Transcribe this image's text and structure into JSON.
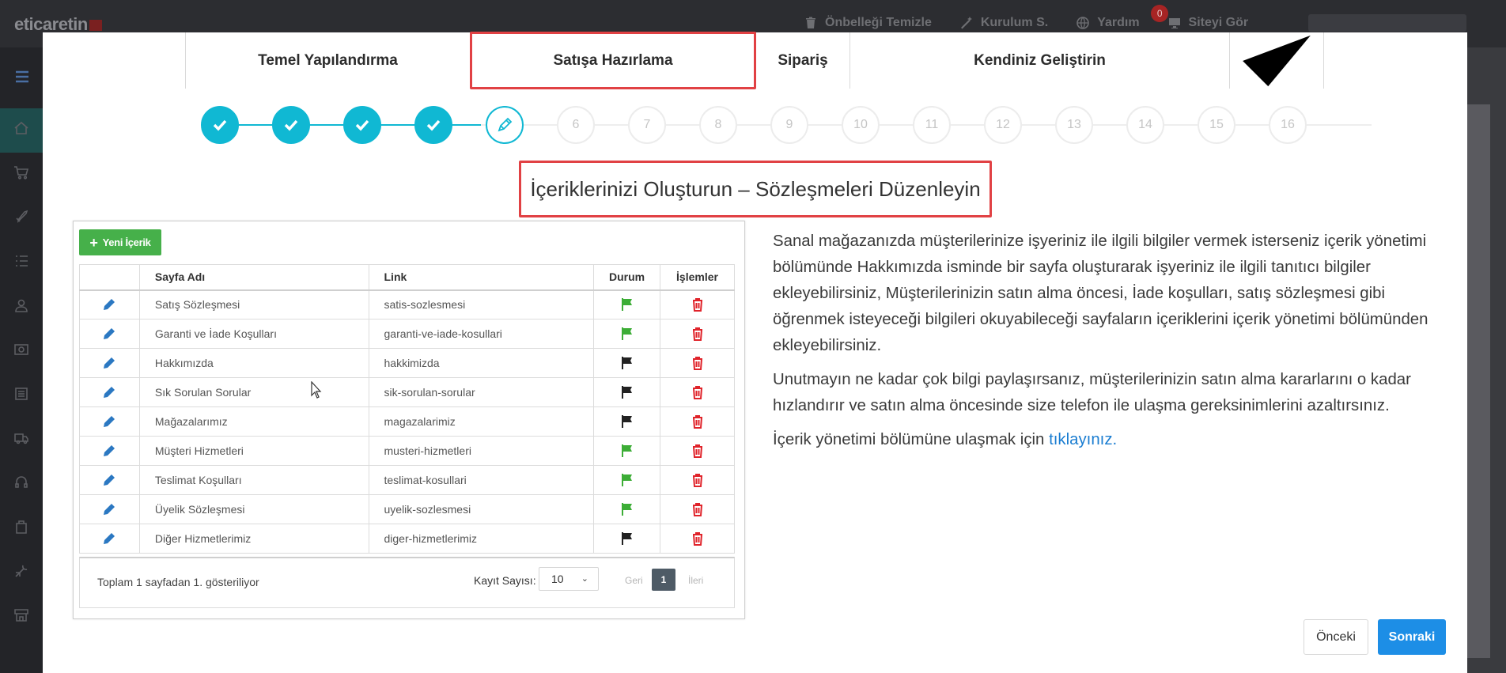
{
  "app": {
    "logo": "eticaretin",
    "nav": [
      {
        "label": "Önbelleği Temizle",
        "icon": "trash-icon"
      },
      {
        "label": "Kurulum S.",
        "icon": "wand-icon"
      },
      {
        "label": "Yardım",
        "icon": "globe-icon",
        "badge": "0"
      },
      {
        "label": "Siteyi Gör",
        "icon": "monitor-icon"
      }
    ]
  },
  "wizard": {
    "tabs": [
      "Temel Yapılandırma",
      "Satışa Hazırlama",
      "Sipariş",
      "Kendiniz Geliştirin"
    ],
    "active_tab": "Satışa Hazırlama",
    "steps_done": 4,
    "current_step": 5,
    "pending_steps": [
      "6",
      "7",
      "8",
      "9",
      "10",
      "11",
      "12",
      "13",
      "14",
      "15",
      "16"
    ],
    "heading": "İçeriklerinizi Oluşturun – Sözleşmeleri Düzenleyin"
  },
  "content_panel": {
    "new_button": "Yeni İçerik",
    "columns": [
      "Sayfa Adı",
      "Link",
      "Durum",
      "İşlemler"
    ],
    "rows": [
      {
        "name": "Satış Sözleşmesi",
        "link": "satis-sozlesmesi",
        "status": "green"
      },
      {
        "name": "Garanti ve İade Koşulları",
        "link": "garanti-ve-iade-kosullari",
        "status": "green"
      },
      {
        "name": "Hakkımızda",
        "link": "hakkimizda",
        "status": "black"
      },
      {
        "name": "Sık Sorulan Sorular",
        "link": "sik-sorulan-sorular",
        "status": "black"
      },
      {
        "name": "Mağazalarımız",
        "link": "magazalarimiz",
        "status": "black"
      },
      {
        "name": "Müşteri Hizmetleri",
        "link": "musteri-hizmetleri",
        "status": "green"
      },
      {
        "name": "Teslimat Koşulları",
        "link": "teslimat-kosullari",
        "status": "green"
      },
      {
        "name": "Üyelik Sözleşmesi",
        "link": "uyelik-sozlesmesi",
        "status": "green"
      },
      {
        "name": "Diğer Hizmetlerimiz",
        "link": "diger-hizmetlerimiz",
        "status": "black"
      }
    ],
    "footer": {
      "total_text": "Toplam 1 sayfadan 1. gösteriliyor",
      "records_label": "Kayıt Sayısı:",
      "records_value": "10",
      "prev": "Geri",
      "page": "1",
      "next": "İleri"
    }
  },
  "description": {
    "p1": "Sanal mağazanızda müşterilerinize işyeriniz ile ilgili bilgiler vermek isterseniz içerik yönetimi bölümünde Hakkımızda isminde bir sayfa oluşturarak işyeriniz ile ilgili tanıtıcı bilgiler ekleyebilirsiniz, Müşterilerinizin satın alma öncesi, İade koşulları, satış sözleşmesi gibi öğrenmek isteyeceği bilgileri okuyabileceği sayfaların içeriklerini içerik yönetimi bölümünden ekleyebilirsiniz.",
    "p2": "Unutmayın ne kadar çok bilgi paylaşırsanız, müşterilerinizin satın alma kararlarını o kadar hızlandırır ve satın alma öncesinde size telefon ile ulaşma gereksinimlerini azaltırsınız.",
    "p3_prefix": "İçerik yönetimi bölümüne ulaşmak için ",
    "p3_link": "tıklayınız."
  },
  "buttons": {
    "prev": "Önceki",
    "next": "Sonraki"
  },
  "colors": {
    "accent_cyan": "#10b8d3",
    "highlight_red": "#e14144",
    "primary_blue": "#1d8ee6",
    "success_green": "#46b04a",
    "flag_green": "#3cad36",
    "flag_black": "#222222",
    "delete_red": "#e0232a"
  }
}
